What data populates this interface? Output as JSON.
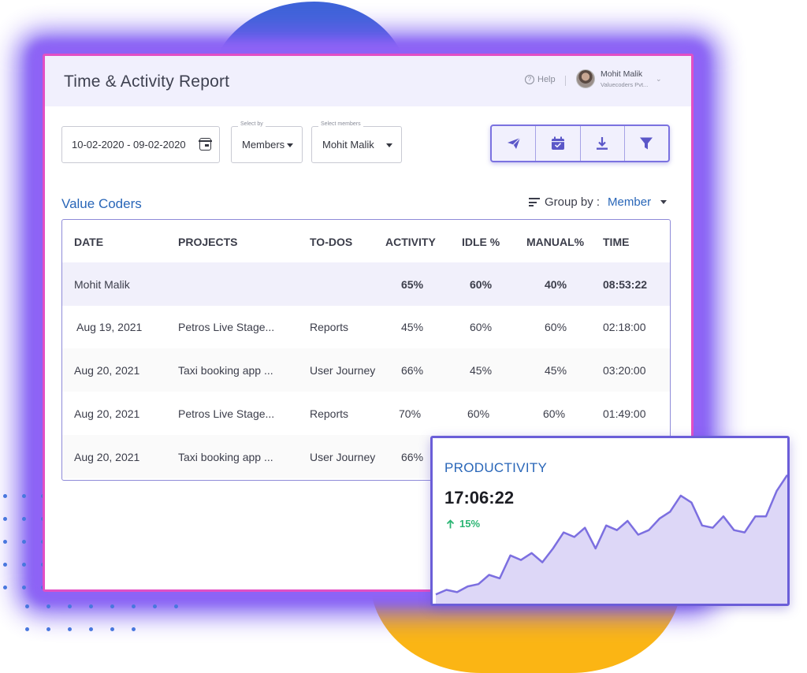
{
  "window": {
    "title": "Time & Activity Report",
    "help_label": "Help",
    "user": {
      "name": "Mohit Malik",
      "company": "Valuecoders Pvt..."
    }
  },
  "filters": {
    "date_range": "10-02-2020 - 09-02-2020",
    "select_by": {
      "label": "Select by",
      "value": "Members"
    },
    "select_members": {
      "label": "Select members",
      "value": "Mohit Malik"
    }
  },
  "toolbar": {
    "buttons": [
      "send-icon",
      "calendar-check-icon",
      "download-icon",
      "filter-icon"
    ]
  },
  "report": {
    "section_title": "Value Coders",
    "group_by_label": "Group by :",
    "group_by_value": "Member",
    "columns": [
      "DATE",
      "PROJECTS",
      "TO-DOS",
      "ACTIVITY",
      "IDLE %",
      "MANUAL%",
      "TIME"
    ],
    "summary": {
      "name": "Mohit Malik",
      "activity": "65%",
      "idle": "60%",
      "manual": "40%",
      "time": "08:53:22"
    },
    "rows": [
      {
        "date": "Aug 19, 2021",
        "project": "Petros Live Stage...",
        "todo": "Reports",
        "activity": "45%",
        "idle": "60%",
        "manual": "60%",
        "time": "02:18:00"
      },
      {
        "date": "Aug 20, 2021",
        "project": "Taxi booking app ...",
        "todo": "User Journey",
        "activity": "66%",
        "idle": "45%",
        "manual": "45%",
        "time": "03:20:00"
      },
      {
        "date": "Aug 20, 2021",
        "project": "Petros Live Stage...",
        "todo": "Reports",
        "activity": "70%",
        "idle": "60%",
        "manual": "60%",
        "time": "01:49:00"
      },
      {
        "date": "Aug 20, 2021",
        "project": "Taxi booking app ...",
        "todo": "User Journey",
        "activity": "66%",
        "idle": "",
        "manual": "",
        "time": ""
      }
    ]
  },
  "productivity": {
    "title": "PRODUCTIVITY",
    "total": "17:06:22",
    "change": "15%",
    "trend_icon": "arrow-up-icon",
    "colors": {
      "line": "#7c6fe0",
      "fill": "#ddd7f7",
      "positive": "#2bb573"
    },
    "chart_data": {
      "type": "area",
      "series": [
        {
          "values": [
            8,
            12,
            10,
            15,
            17,
            25,
            22,
            42,
            38,
            44,
            36,
            48,
            62,
            58,
            66,
            48,
            68,
            64,
            72,
            60,
            64,
            74,
            80,
            94,
            88,
            68,
            66,
            76,
            64,
            62,
            76,
            76,
            98,
            112
          ]
        }
      ],
      "ylim": [
        0,
        120
      ],
      "grid": false
    }
  }
}
